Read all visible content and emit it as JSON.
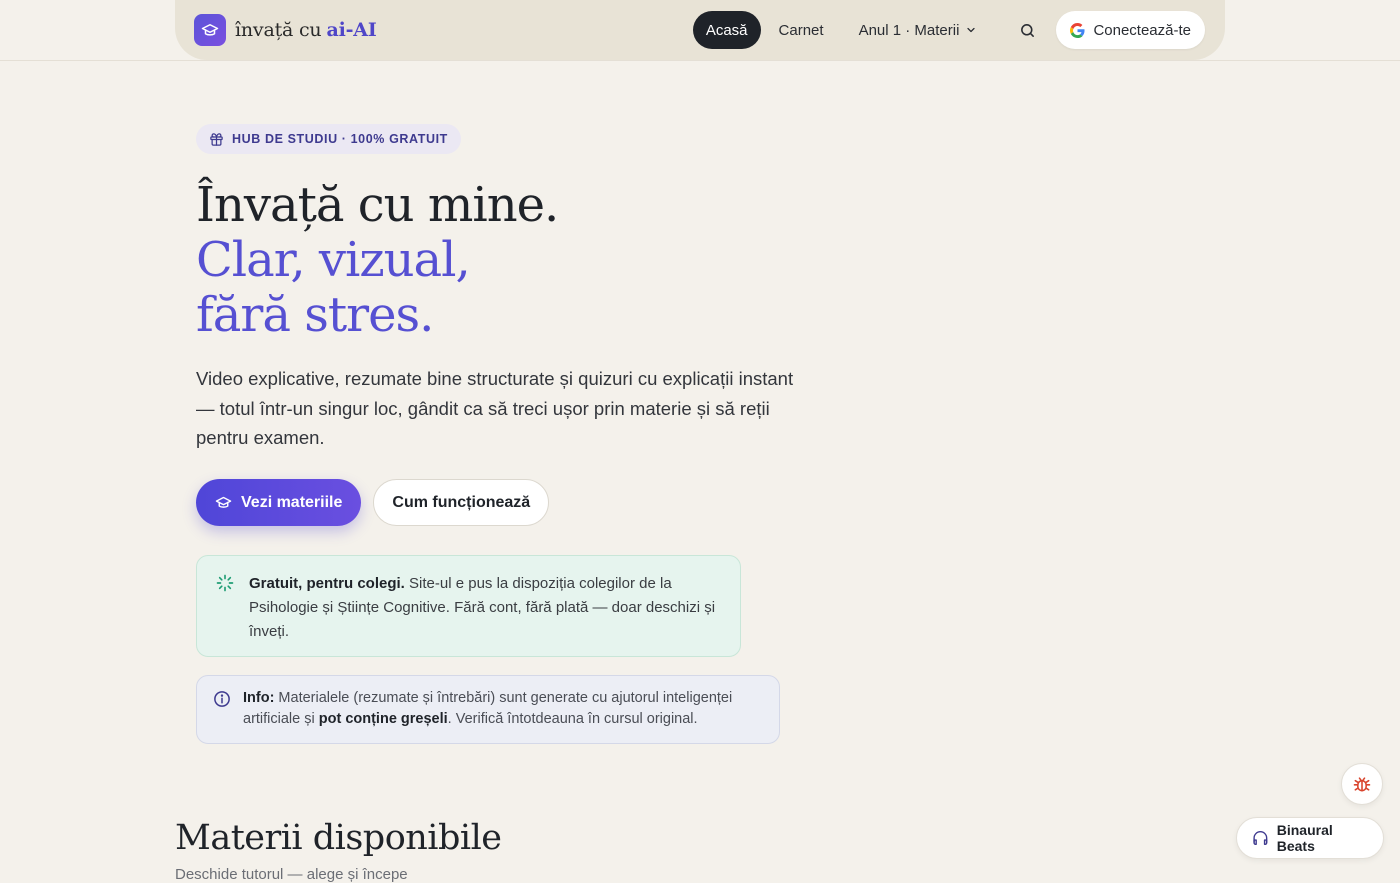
{
  "brand": {
    "name": "învață cu",
    "accent": "ai-AI"
  },
  "nav": {
    "home": "Acasă",
    "notebook": "Carnet",
    "subjects_dropdown": "Anul 1 · Materii",
    "login": "Conectează-te"
  },
  "hero": {
    "badge": "HUB DE STUDIU · 100% GRATUIT",
    "title_line1": "Învață cu mine.",
    "title_line2": "Clar, vizual, fără stres.",
    "description": "Video explicative, rezumate bine structurate și quizuri cu explicații instant — totul într-un singur loc, gândit ca să treci ușor prin materie și să reții pentru examen.",
    "primary_cta": "Vezi materiile",
    "secondary_cta": "Cum funcționează"
  },
  "notes": {
    "free_title": "Gratuit, pentru colegi.",
    "free_text": " Site-ul e pus la dispoziția colegilor de la Psihologie și Științe Cognitive. Fără cont, fără plată — doar deschizi și înveți.",
    "info_label": "Info:",
    "info_text_1": " Materialele (rezumate și întrebări) sunt generate cu ajutorul inteligenței artificiale și ",
    "info_bold": "pot conține greșeli",
    "info_text_2": ". Verifică întotdeauna în cursul original."
  },
  "section": {
    "title": "Materii disponibile",
    "subtitle": "Deschide tutorul — alege și începe"
  },
  "floating": {
    "beats": "Binaural Beats"
  },
  "colors": {
    "background": "#f4f1eb",
    "accent": "#5650d2",
    "nav_active": "#1f2329",
    "note_green": "#e6f4ee",
    "note_info": "#eceef5",
    "bug_red": "#d9452e"
  },
  "icons": {
    "logo": "graduation-cap-icon",
    "search": "search-icon",
    "google": "google-icon",
    "badge": "gift-icon",
    "primary_cta": "graduation-cap-icon",
    "free_note": "spinner-icon",
    "info_note": "info-icon",
    "bug": "bug-icon",
    "beats": "headphones-icon"
  }
}
